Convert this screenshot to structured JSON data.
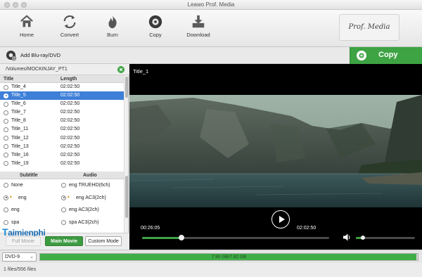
{
  "window": {
    "title": "Leawo Prof. Media"
  },
  "toolbar": {
    "home": "Home",
    "convert": "Convert",
    "burn": "Burn",
    "copy": "Copy",
    "download": "Download",
    "brand": "Prof. Media"
  },
  "actionbar": {
    "add_label": "Add Blu-ray/DVD",
    "copy_label": "Copy",
    "accent": "#3ea343"
  },
  "source": {
    "path": "/Volumes/MOCKINJAY_PT1"
  },
  "title_table": {
    "headers": {
      "title": "Title",
      "length": "Length"
    },
    "rows": [
      {
        "name": "Title_4",
        "length": "02:02:50",
        "selected": false
      },
      {
        "name": "Title_5",
        "length": "02:02:50",
        "selected": true
      },
      {
        "name": "Title_6",
        "length": "02:02:50",
        "selected": false
      },
      {
        "name": "Title_7",
        "length": "02:02:50",
        "selected": false
      },
      {
        "name": "Title_8",
        "length": "02:02:50",
        "selected": false
      },
      {
        "name": "Title_11",
        "length": "02:02:50",
        "selected": false
      },
      {
        "name": "Title_12",
        "length": "02:02:50",
        "selected": false
      },
      {
        "name": "Title_13",
        "length": "02:02:50",
        "selected": false
      },
      {
        "name": "Title_16",
        "length": "02:02:50",
        "selected": false
      },
      {
        "name": "Title_19",
        "length": "02:02:50",
        "selected": false
      }
    ]
  },
  "tracks": {
    "headers": {
      "subtitle": "Subtitle",
      "audio": "Audio"
    },
    "rows": [
      {
        "subtitle": "None",
        "sub_on": false,
        "sub_speaker": false,
        "audio": "eng TRUEHD(6ch)",
        "audio_on": false,
        "audio_speaker": false
      },
      {
        "subtitle": "eng",
        "sub_on": true,
        "sub_speaker": true,
        "audio": "eng AC3(2ch)",
        "audio_on": true,
        "audio_speaker": true
      },
      {
        "subtitle": "eng",
        "sub_on": false,
        "sub_speaker": false,
        "audio": "eng AC3(2ch)",
        "audio_on": false,
        "audio_speaker": false
      },
      {
        "subtitle": "spa",
        "sub_on": false,
        "sub_speaker": false,
        "audio": "spa AC3(2ch)",
        "audio_on": false,
        "audio_speaker": false
      }
    ]
  },
  "modes": {
    "full": "Full Movie",
    "main": "Main Movie",
    "custom": "Custom Mode"
  },
  "watermark": {
    "prefix": "T",
    "text": "aimienphi"
  },
  "player": {
    "title": "Title_1",
    "current_time": "00:26:05",
    "total_time": "02:02:50",
    "progress": 0.21,
    "volume": 0.12
  },
  "output": {
    "disc_type": "DVD-9",
    "capacity_text": "7.90 GB/7.92 GB",
    "capacity_fraction": 0.997
  },
  "status": {
    "files": "1 files/556 files"
  }
}
